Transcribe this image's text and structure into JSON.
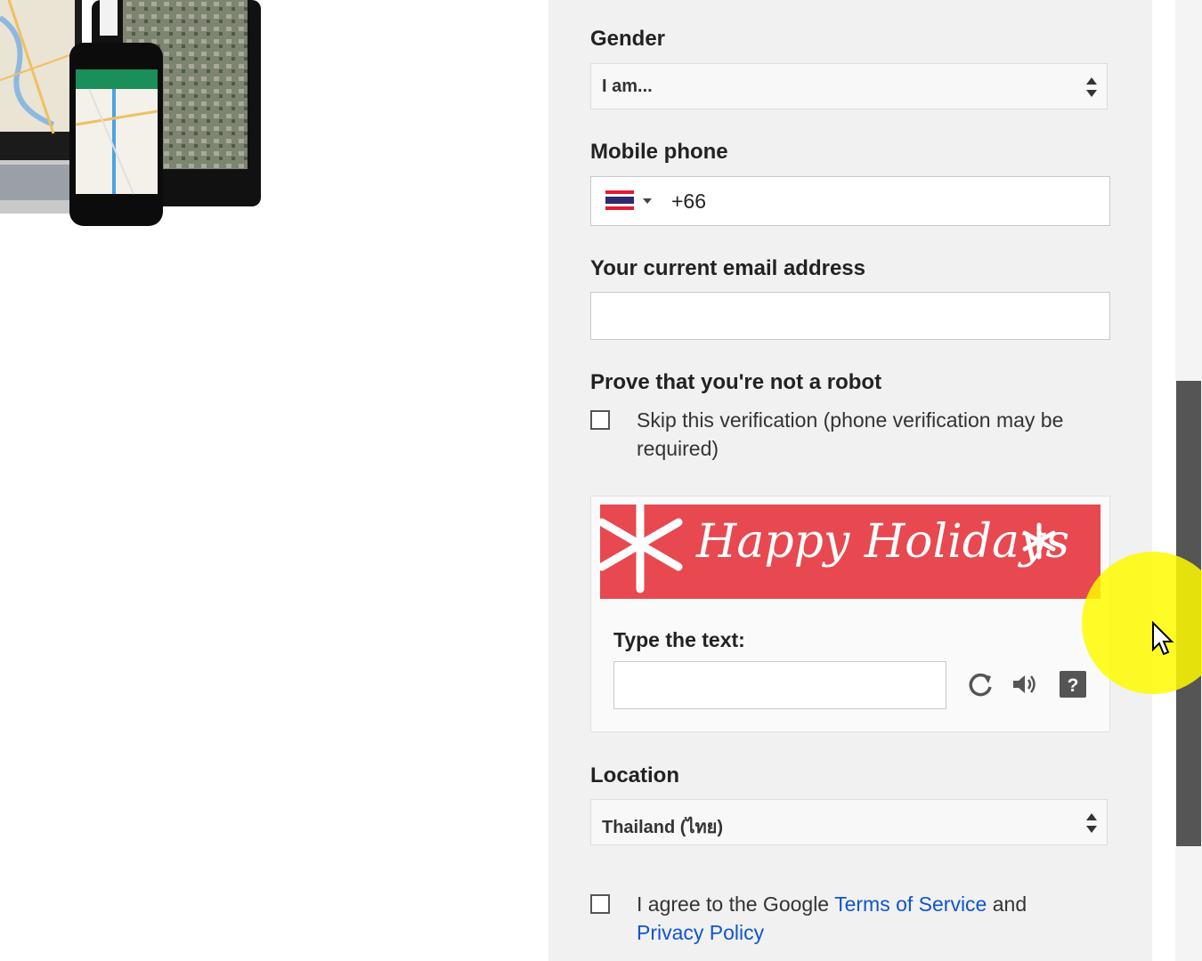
{
  "form": {
    "gender": {
      "label": "Gender",
      "selected": "I am..."
    },
    "mobile": {
      "label": "Mobile phone",
      "country_code": "+66"
    },
    "email": {
      "label": "Your current email address",
      "value": ""
    },
    "robot": {
      "label": "Prove that you're not a robot",
      "skip_text_line1": "Skip this verification (phone verification may be",
      "skip_text_line2": "required)"
    },
    "captcha": {
      "banner_text": "Happy Holidays",
      "type_label": "Type the text:",
      "icons": [
        "refresh-icon",
        "audio-icon",
        "help-icon"
      ]
    },
    "location": {
      "label": "Location",
      "selected": "Thailand (ไทย)"
    },
    "agree": {
      "text_prefix": "I agree to the Google ",
      "terms_link": "Terms of Service",
      "text_mid": " and",
      "privacy_link": "Privacy Policy"
    }
  },
  "colors": {
    "banner": "#e8484f",
    "link": "#1155cc",
    "panel": "#f1f1f1",
    "scroll_thumb": "#555555",
    "cursor_highlight": "#fff700"
  }
}
